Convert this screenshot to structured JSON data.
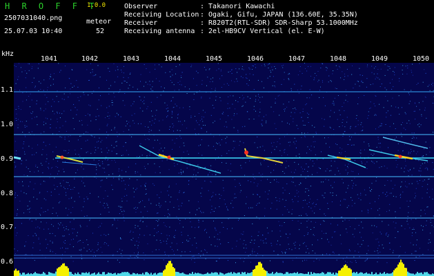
{
  "header": {
    "brand": "H R O F F T",
    "version": "1.0.0",
    "filename": "2507031040.png",
    "meteor_label": "meteor",
    "timestamp": "25.07.03 10:40",
    "meteor_count": "52"
  },
  "info": [
    {
      "label": "Observer",
      "value": ": Takanori Kawachi"
    },
    {
      "label": "Receiving Location",
      "value": ": Ogaki, Gifu, JAPAN (136.60E, 35.35N)"
    },
    {
      "label": "Receiver",
      "value": ": R820T2(RTL-SDR) SDR-Sharp 53.1000MHz"
    },
    {
      "label": "Receiving antenna",
      "value": ": 2el-HB9CV Vertical (el. E-W)"
    }
  ],
  "axes": {
    "y_unit": "kHz",
    "x_ticks": [
      "1041",
      "1042",
      "1043",
      "1044",
      "1045",
      "1046",
      "1047",
      "1048",
      "1049",
      "1050"
    ],
    "y_ticks": [
      "1.1",
      "1.0",
      "0.9",
      "0.8",
      "0.7",
      "0.6"
    ]
  },
  "colors": {
    "background": "#000000",
    "spectrogram_bg": "#05064a",
    "brand_green": "#2bd12b",
    "version_yellow": "#f2e600",
    "carrier_cyan": "#3fe0ff",
    "histogram_yellow": "#f5f000"
  }
}
